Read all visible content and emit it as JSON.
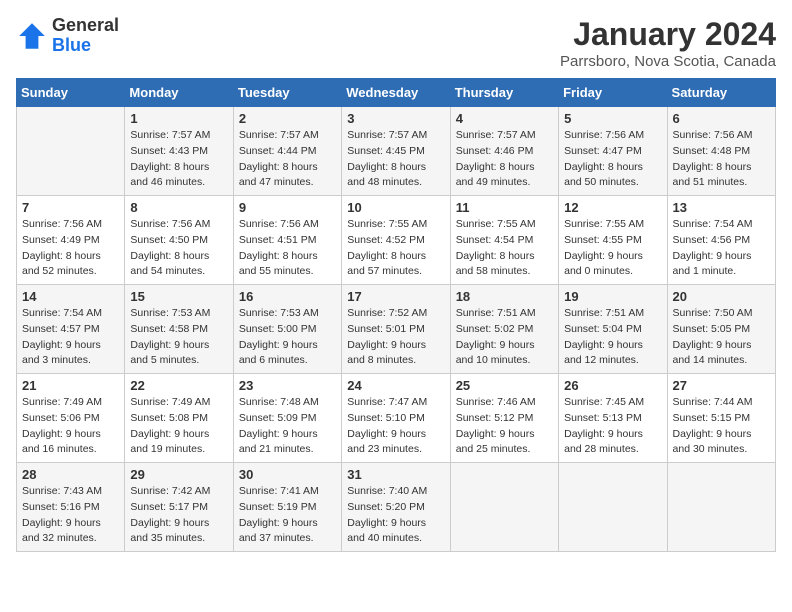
{
  "header": {
    "logo_general": "General",
    "logo_blue": "Blue",
    "month_title": "January 2024",
    "location": "Parrsboro, Nova Scotia, Canada"
  },
  "days_of_week": [
    "Sunday",
    "Monday",
    "Tuesday",
    "Wednesday",
    "Thursday",
    "Friday",
    "Saturday"
  ],
  "weeks": [
    [
      {
        "num": "",
        "info": ""
      },
      {
        "num": "1",
        "info": "Sunrise: 7:57 AM\nSunset: 4:43 PM\nDaylight: 8 hours\nand 46 minutes."
      },
      {
        "num": "2",
        "info": "Sunrise: 7:57 AM\nSunset: 4:44 PM\nDaylight: 8 hours\nand 47 minutes."
      },
      {
        "num": "3",
        "info": "Sunrise: 7:57 AM\nSunset: 4:45 PM\nDaylight: 8 hours\nand 48 minutes."
      },
      {
        "num": "4",
        "info": "Sunrise: 7:57 AM\nSunset: 4:46 PM\nDaylight: 8 hours\nand 49 minutes."
      },
      {
        "num": "5",
        "info": "Sunrise: 7:56 AM\nSunset: 4:47 PM\nDaylight: 8 hours\nand 50 minutes."
      },
      {
        "num": "6",
        "info": "Sunrise: 7:56 AM\nSunset: 4:48 PM\nDaylight: 8 hours\nand 51 minutes."
      }
    ],
    [
      {
        "num": "7",
        "info": "Sunrise: 7:56 AM\nSunset: 4:49 PM\nDaylight: 8 hours\nand 52 minutes."
      },
      {
        "num": "8",
        "info": "Sunrise: 7:56 AM\nSunset: 4:50 PM\nDaylight: 8 hours\nand 54 minutes."
      },
      {
        "num": "9",
        "info": "Sunrise: 7:56 AM\nSunset: 4:51 PM\nDaylight: 8 hours\nand 55 minutes."
      },
      {
        "num": "10",
        "info": "Sunrise: 7:55 AM\nSunset: 4:52 PM\nDaylight: 8 hours\nand 57 minutes."
      },
      {
        "num": "11",
        "info": "Sunrise: 7:55 AM\nSunset: 4:54 PM\nDaylight: 8 hours\nand 58 minutes."
      },
      {
        "num": "12",
        "info": "Sunrise: 7:55 AM\nSunset: 4:55 PM\nDaylight: 9 hours\nand 0 minutes."
      },
      {
        "num": "13",
        "info": "Sunrise: 7:54 AM\nSunset: 4:56 PM\nDaylight: 9 hours\nand 1 minute."
      }
    ],
    [
      {
        "num": "14",
        "info": "Sunrise: 7:54 AM\nSunset: 4:57 PM\nDaylight: 9 hours\nand 3 minutes."
      },
      {
        "num": "15",
        "info": "Sunrise: 7:53 AM\nSunset: 4:58 PM\nDaylight: 9 hours\nand 5 minutes."
      },
      {
        "num": "16",
        "info": "Sunrise: 7:53 AM\nSunset: 5:00 PM\nDaylight: 9 hours\nand 6 minutes."
      },
      {
        "num": "17",
        "info": "Sunrise: 7:52 AM\nSunset: 5:01 PM\nDaylight: 9 hours\nand 8 minutes."
      },
      {
        "num": "18",
        "info": "Sunrise: 7:51 AM\nSunset: 5:02 PM\nDaylight: 9 hours\nand 10 minutes."
      },
      {
        "num": "19",
        "info": "Sunrise: 7:51 AM\nSunset: 5:04 PM\nDaylight: 9 hours\nand 12 minutes."
      },
      {
        "num": "20",
        "info": "Sunrise: 7:50 AM\nSunset: 5:05 PM\nDaylight: 9 hours\nand 14 minutes."
      }
    ],
    [
      {
        "num": "21",
        "info": "Sunrise: 7:49 AM\nSunset: 5:06 PM\nDaylight: 9 hours\nand 16 minutes."
      },
      {
        "num": "22",
        "info": "Sunrise: 7:49 AM\nSunset: 5:08 PM\nDaylight: 9 hours\nand 19 minutes."
      },
      {
        "num": "23",
        "info": "Sunrise: 7:48 AM\nSunset: 5:09 PM\nDaylight: 9 hours\nand 21 minutes."
      },
      {
        "num": "24",
        "info": "Sunrise: 7:47 AM\nSunset: 5:10 PM\nDaylight: 9 hours\nand 23 minutes."
      },
      {
        "num": "25",
        "info": "Sunrise: 7:46 AM\nSunset: 5:12 PM\nDaylight: 9 hours\nand 25 minutes."
      },
      {
        "num": "26",
        "info": "Sunrise: 7:45 AM\nSunset: 5:13 PM\nDaylight: 9 hours\nand 28 minutes."
      },
      {
        "num": "27",
        "info": "Sunrise: 7:44 AM\nSunset: 5:15 PM\nDaylight: 9 hours\nand 30 minutes."
      }
    ],
    [
      {
        "num": "28",
        "info": "Sunrise: 7:43 AM\nSunset: 5:16 PM\nDaylight: 9 hours\nand 32 minutes."
      },
      {
        "num": "29",
        "info": "Sunrise: 7:42 AM\nSunset: 5:17 PM\nDaylight: 9 hours\nand 35 minutes."
      },
      {
        "num": "30",
        "info": "Sunrise: 7:41 AM\nSunset: 5:19 PM\nDaylight: 9 hours\nand 37 minutes."
      },
      {
        "num": "31",
        "info": "Sunrise: 7:40 AM\nSunset: 5:20 PM\nDaylight: 9 hours\nand 40 minutes."
      },
      {
        "num": "",
        "info": ""
      },
      {
        "num": "",
        "info": ""
      },
      {
        "num": "",
        "info": ""
      }
    ]
  ]
}
